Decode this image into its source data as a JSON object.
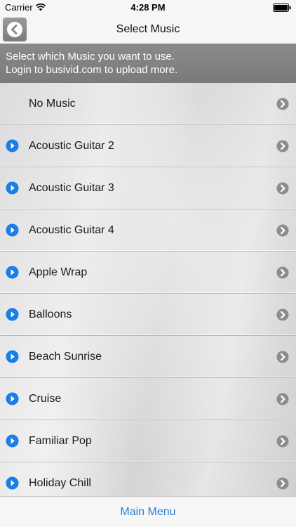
{
  "status_bar": {
    "carrier": "Carrier",
    "time": "4:28 PM"
  },
  "nav": {
    "title": "Select Music",
    "back_icon": "chevron-left-icon"
  },
  "banner": {
    "line1": "Select which Music you want to use.",
    "line2": "Login to busivid.com to upload more."
  },
  "music_list": {
    "items": [
      {
        "label": "No Music",
        "has_play": false
      },
      {
        "label": "Acoustic Guitar 2",
        "has_play": true
      },
      {
        "label": "Acoustic Guitar 3",
        "has_play": true
      },
      {
        "label": "Acoustic Guitar 4",
        "has_play": true
      },
      {
        "label": "Apple Wrap",
        "has_play": true
      },
      {
        "label": "Balloons",
        "has_play": true
      },
      {
        "label": "Beach Sunrise",
        "has_play": true
      },
      {
        "label": "Cruise",
        "has_play": true
      },
      {
        "label": "Familiar Pop",
        "has_play": true
      },
      {
        "label": "Holiday Chill",
        "has_play": true
      }
    ]
  },
  "footer": {
    "main_menu_label": "Main Menu"
  },
  "colors": {
    "accent_blue": "#1a7ee6",
    "chevron_gray": "#8c8c8c",
    "banner_gray": "#808080",
    "link_blue": "#2a7fcf"
  }
}
